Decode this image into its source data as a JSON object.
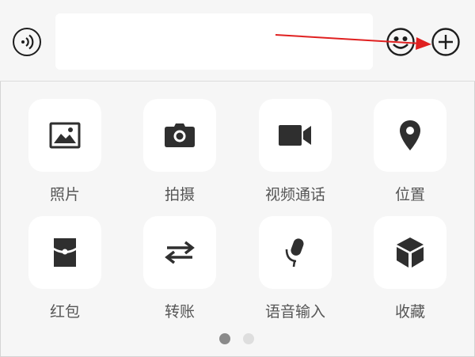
{
  "input_bar": {
    "text_value": "",
    "voice_icon": "voice-wave-icon",
    "emoji_icon": "smiley-icon",
    "more_icon": "plus-circle-icon",
    "annotation_arrow_color": "#e02020"
  },
  "tiles": [
    {
      "label": "照片",
      "icon": "photo-icon"
    },
    {
      "label": "拍摄",
      "icon": "camera-icon"
    },
    {
      "label": "视频通话",
      "icon": "video-call-icon"
    },
    {
      "label": "位置",
      "icon": "location-pin-icon"
    },
    {
      "label": "红包",
      "icon": "red-packet-icon"
    },
    {
      "label": "转账",
      "icon": "transfer-icon"
    },
    {
      "label": "语音输入",
      "icon": "microphone-icon"
    },
    {
      "label": "收藏",
      "icon": "favorites-cube-icon"
    }
  ],
  "pager": {
    "pages": 2,
    "current": 1
  },
  "colors": {
    "background": "#f6f6f6",
    "tile": "#ffffff",
    "icon": "#2f2f2f",
    "label": "#565656"
  }
}
